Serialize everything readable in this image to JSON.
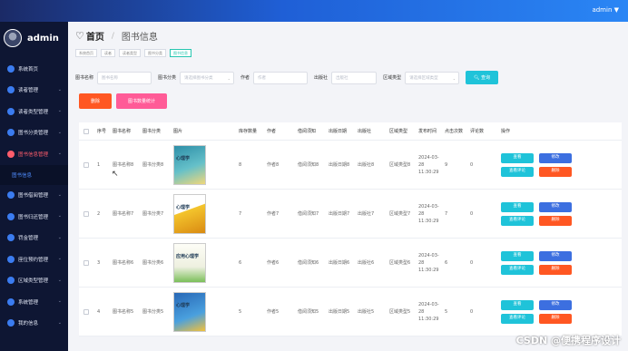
{
  "top": {
    "user": "admin ▼"
  },
  "sidebar": {
    "brand": "admin",
    "items": [
      {
        "label": "系统首页",
        "chev": ""
      },
      {
        "label": "读者管理",
        "chev": "⌄"
      },
      {
        "label": "读者类型管理",
        "chev": "⌄"
      },
      {
        "label": "图书分类管理",
        "chev": "⌄"
      },
      {
        "label": "图书信息管理",
        "chev": "⌄",
        "active": true
      },
      {
        "label": "图书借阅管理",
        "chev": "⌄"
      },
      {
        "label": "图书归还管理",
        "chev": "⌄"
      },
      {
        "label": "罚金管理",
        "chev": "⌄"
      },
      {
        "label": "座位预约管理",
        "chev": "⌄"
      },
      {
        "label": "区域类型管理",
        "chev": "⌄"
      },
      {
        "label": "系统管理",
        "chev": "⌄"
      },
      {
        "label": "我的信息",
        "chev": "⌄"
      }
    ],
    "submenu": "图书信息"
  },
  "breadcrumb": {
    "home": "首页",
    "current": "图书信息"
  },
  "tags": [
    "系统首页",
    "读者",
    "读者类型",
    "图书分类",
    "图书信息"
  ],
  "search": {
    "fields": [
      {
        "label": "图书名称",
        "placeholder": "图书名称",
        "width": 60,
        "dropdown": false
      },
      {
        "label": "图书分类",
        "placeholder": "请选择图书分类",
        "width": 60,
        "dropdown": true
      },
      {
        "label": "作者",
        "placeholder": "作者",
        "width": 60,
        "dropdown": false
      },
      {
        "label": "出版社",
        "placeholder": "出版社",
        "width": 50,
        "dropdown": false
      },
      {
        "label": "区域类型",
        "placeholder": "请选择区域类型",
        "width": 60,
        "dropdown": true
      }
    ],
    "button": "查询"
  },
  "actions": {
    "delete": "删除",
    "stats": "图书数量统计"
  },
  "table": {
    "headers": [
      "",
      "序号",
      "图书名称",
      "图书分类",
      "图片",
      "库存数量",
      "作者",
      "借阅须知",
      "出版日期",
      "出版社",
      "区域类型",
      "发布时间",
      "点击次数",
      "评论数",
      "操作"
    ],
    "rows": [
      {
        "idx": "1",
        "name": "图书名称8",
        "cat": "图书分类8",
        "cover_title": "心理学",
        "stock": "8",
        "author": "作者8",
        "notice": "借阅须知8",
        "date": "出版日期8",
        "pub": "出版社8",
        "area": "区域类型8",
        "time": "2024-03-28 11:30:29",
        "clicks": "9",
        "comments": "0"
      },
      {
        "idx": "2",
        "name": "图书名称7",
        "cat": "图书分类7",
        "cover_title": "心理学",
        "stock": "7",
        "author": "作者7",
        "notice": "借阅须知7",
        "date": "出版日期7",
        "pub": "出版社7",
        "area": "区域类型7",
        "time": "2024-03-28 11:30:29",
        "clicks": "7",
        "comments": "0"
      },
      {
        "idx": "3",
        "name": "图书名称6",
        "cat": "图书分类6",
        "cover_title": "应用心理学",
        "stock": "6",
        "author": "作者6",
        "notice": "借阅须知6",
        "date": "出版日期6",
        "pub": "出版社6",
        "area": "区域类型6",
        "time": "2024-03-28 11:30:29",
        "clicks": "6",
        "comments": "0"
      },
      {
        "idx": "4",
        "name": "图书名称5",
        "cat": "图书分类5",
        "cover_title": "心理学",
        "stock": "5",
        "author": "作者5",
        "notice": "借阅须知5",
        "date": "出版日期5",
        "pub": "出版社5",
        "area": "区域类型5",
        "time": "2024-03-28 11:30:29",
        "clicks": "5",
        "comments": "0"
      }
    ],
    "ops": {
      "view": "查看",
      "edit": "修改",
      "comment": "查看评论",
      "delete": "删除"
    }
  },
  "watermark": "CSDN @便携程序设计"
}
